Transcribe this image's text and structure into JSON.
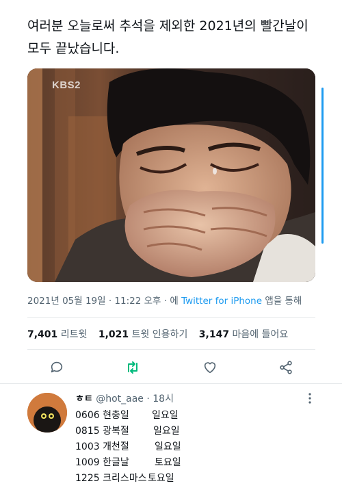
{
  "tweet": {
    "text": "여러분 오늘로써 추석을 제외한 2021년의 빨간날이 모두 끝났습니다.",
    "image_watermark": "KBS2",
    "timestamp": "2021년 05월 19일 · 11:22 오후 · 에",
    "source": "Twitter for iPhone",
    "source_suffix": "앱을 통해"
  },
  "stats": {
    "retweets": "7,401",
    "retweets_label": "리트윗",
    "quotes": "1,021",
    "quotes_label": "트윗 인용하기",
    "likes": "3,147",
    "likes_label": "마음에 들어요"
  },
  "icons": {
    "reply": "comment-icon",
    "retweet": "retweet-icon",
    "like": "heart-icon",
    "share": "share-icon",
    "more": "more-vertical-icon"
  },
  "colors": {
    "accent": "#1d9bf0",
    "retweet_active": "#00ba7c",
    "secondary_text": "#536471"
  },
  "reply": {
    "name": "ㅎㅌ",
    "handle": "@hot_aae",
    "time": "· 18시",
    "lines": [
      {
        "date": "0606 현충일",
        "weekday": "일요일"
      },
      {
        "date": "0815 광복절",
        "weekday": "일요일"
      },
      {
        "date": "1003 개천절",
        "weekday": "일요일"
      },
      {
        "date": "1009 한글날",
        "weekday": "토요일"
      },
      {
        "date": "1225 크리스마스",
        "weekday": "토요일"
      }
    ]
  }
}
